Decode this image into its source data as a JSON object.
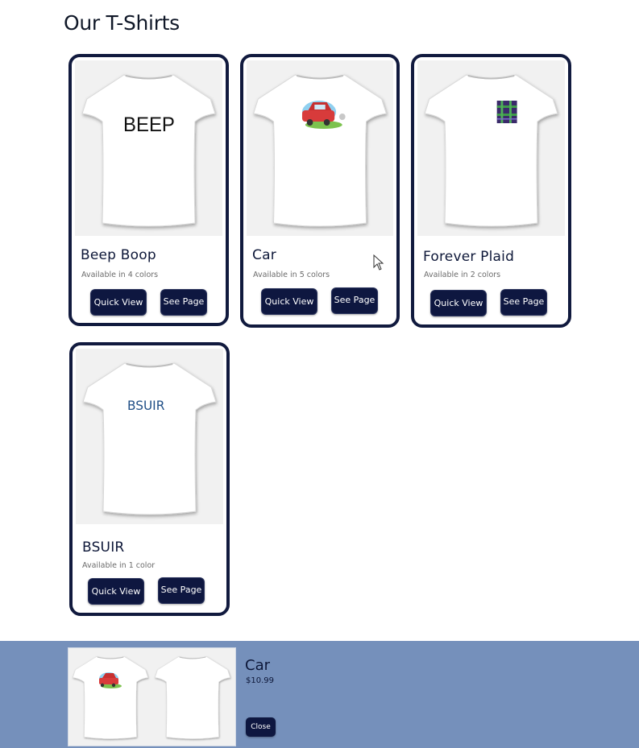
{
  "page": {
    "title": "Our T-Shirts"
  },
  "products": [
    {
      "name": "Beep Boop",
      "availability": "Available in 4 colors",
      "print_text": "BEEP",
      "quick_view": "Quick View",
      "see_page": "See Page"
    },
    {
      "name": "Car",
      "availability": "Available in 5 colors",
      "quick_view": "Quick View",
      "see_page": "See Page"
    },
    {
      "name": "Forever Plaid",
      "availability": "Available in 2 colors",
      "quick_view": "Quick View",
      "see_page": "See Page"
    },
    {
      "name": "BSUIR",
      "availability": "Available in 1 color",
      "print_text": "BSUIR",
      "quick_view": "Quick View",
      "see_page": "See Page"
    }
  ],
  "quick_view_panel": {
    "name": "Car",
    "price": "$10.99",
    "close_label": "Close"
  },
  "colors": {
    "accent": "#0e1740",
    "card_border": "#111a3e",
    "panel_bg": "#7590bb",
    "image_bg": "#f1f1f1"
  }
}
